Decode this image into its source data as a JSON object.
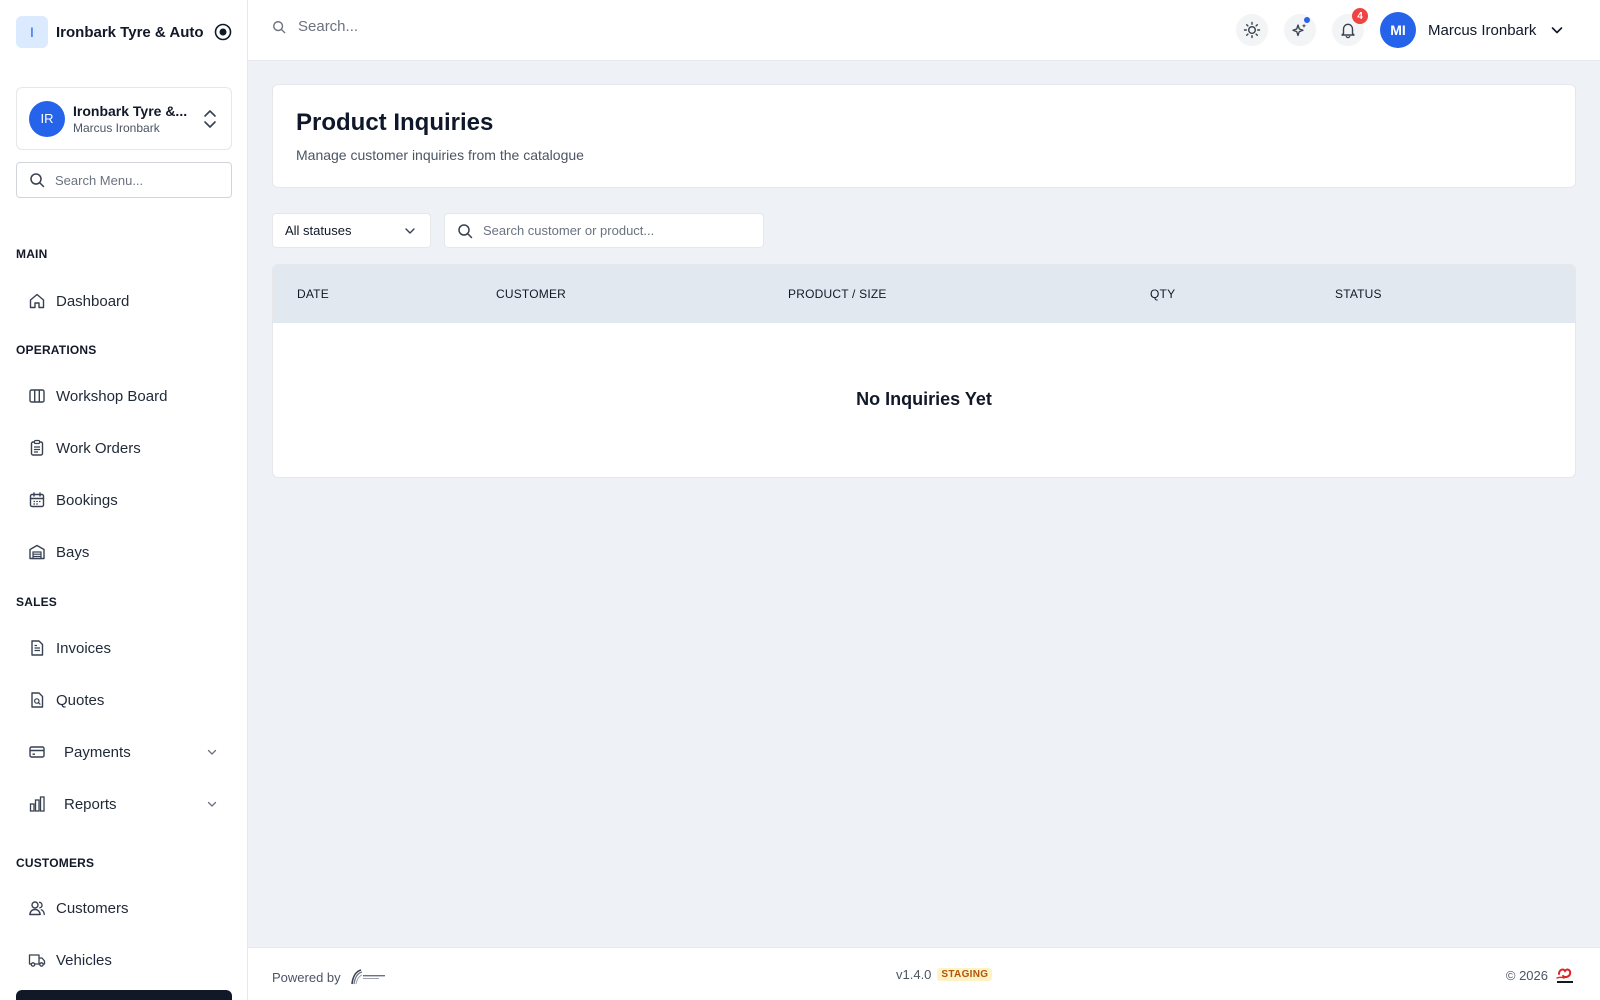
{
  "brand": {
    "logo_letter": "I",
    "name": "Ironbark Tyre & Auto"
  },
  "org_switcher": {
    "initials": "IR",
    "name": "Ironbark Tyre &...",
    "user": "Marcus Ironbark"
  },
  "sidebar": {
    "search_placeholder": "Search Menu...",
    "sections": {
      "main": "MAIN",
      "operations": "OPERATIONS",
      "sales": "SALES",
      "customers": "CUSTOMERS"
    },
    "items": {
      "dashboard": "Dashboard",
      "workshop_board": "Workshop Board",
      "work_orders": "Work Orders",
      "bookings": "Bookings",
      "bays": "Bays",
      "invoices": "Invoices",
      "quotes": "Quotes",
      "payments": "Payments",
      "reports": "Reports",
      "customers": "Customers",
      "vehicles": "Vehicles"
    }
  },
  "header": {
    "search_placeholder": "Search...",
    "notification_count": "4",
    "user_initials": "MI",
    "user_name": "Marcus Ironbark"
  },
  "page": {
    "title": "Product Inquiries",
    "subtitle": "Manage customer inquiries from the catalogue"
  },
  "filters": {
    "status_selected": "All statuses",
    "search_placeholder": "Search customer or product..."
  },
  "table": {
    "columns": [
      "DATE",
      "CUSTOMER",
      "PRODUCT / SIZE",
      "QTY",
      "STATUS"
    ],
    "rows": [],
    "empty_message": "No Inquiries Yet"
  },
  "footer": {
    "powered_by": "Powered by",
    "version": "v1.4.0",
    "environment": "STAGING",
    "copyright": "© 2026"
  },
  "colors": {
    "accent": "#2563eb",
    "page_background": "#eef2f7",
    "table_header": "#e2e8f0",
    "notification_badge": "#ef4444",
    "staging_badge_bg": "#fef3c7",
    "staging_badge_text": "#b45309"
  },
  "icons": {
    "brand_target": "target-icon",
    "org_switch": "chevrons-up-down-icon",
    "search": "search-icon",
    "theme": "sun-icon",
    "ai": "sparkles-icon",
    "notifications": "bell-icon",
    "user_menu": "chevron-down-icon"
  }
}
